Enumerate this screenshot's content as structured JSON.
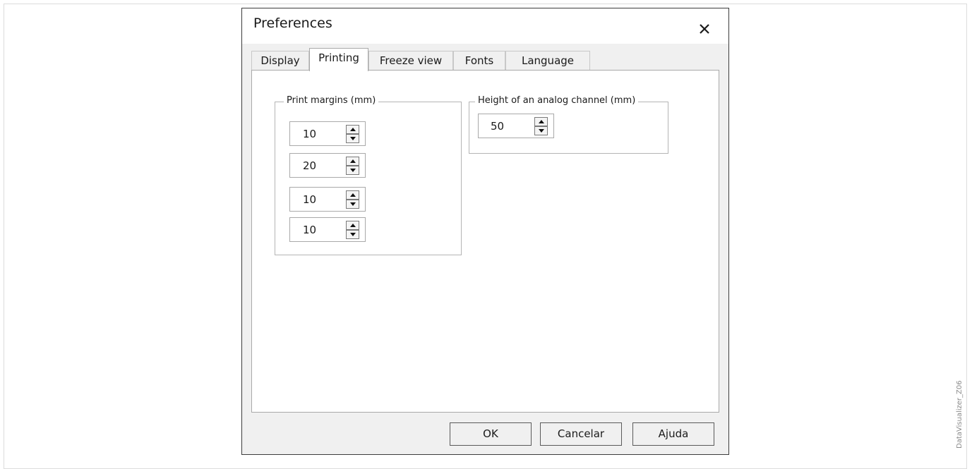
{
  "dialog": {
    "title": "Preferences",
    "close_icon": "close-icon"
  },
  "tabs": [
    {
      "label": "Display",
      "active": false
    },
    {
      "label": "Printing",
      "active": true
    },
    {
      "label": "Freeze view",
      "active": false
    },
    {
      "label": "Fonts",
      "active": false
    },
    {
      "label": "Language",
      "active": false
    }
  ],
  "print_margins": {
    "label": "Print margins (mm)",
    "values": [
      "10",
      "20",
      "10",
      "10"
    ]
  },
  "analog_channel": {
    "label": "Height of an analog channel (mm)",
    "value": "50"
  },
  "buttons": {
    "ok": "OK",
    "cancel": "Cancelar",
    "help": "Ajuda"
  },
  "watermark": "DataVisualizer_Z06",
  "colors": {
    "dialog_background": "#f0f0f0",
    "panel_background": "#ffffff",
    "border": "#a9a9a9"
  }
}
